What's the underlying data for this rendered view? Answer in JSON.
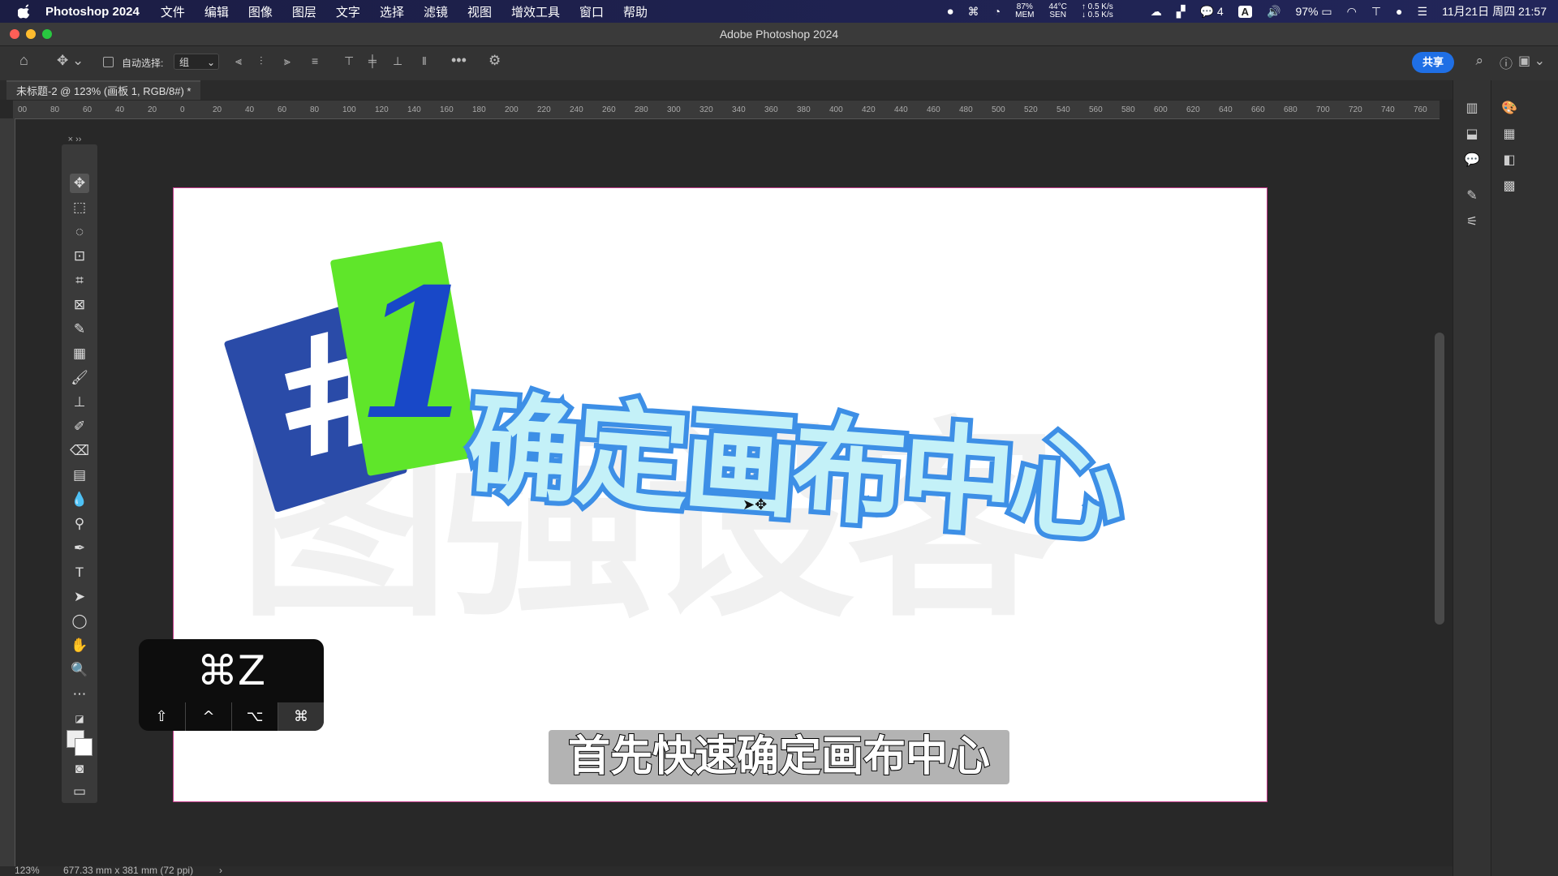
{
  "menubar": {
    "app_name": "Photoshop 2024",
    "menus": [
      "文件",
      "编辑",
      "图像",
      "图层",
      "文字",
      "选择",
      "滤镜",
      "视图",
      "增效工具",
      "窗口",
      "帮助"
    ],
    "stats": {
      "mem": "87%",
      "mem_label": "MEM",
      "temp": "44°C",
      "temp_label": "SEN",
      "net_up": "↑ 0.5 K/s",
      "net_down": "↓ 0.5 K/s"
    },
    "wechat_count": "4",
    "input_method": "A",
    "battery": "97%",
    "datetime": "11月21日 周四 21:57"
  },
  "window": {
    "title": "Adobe Photoshop 2024"
  },
  "options": {
    "auto_select_label": "自动选择:",
    "auto_select_value": "组",
    "share_label": "共享"
  },
  "document_tab": {
    "label": "未标题-2 @ 123% (画板 1, RGB/8#) *"
  },
  "ruler_top_ticks": [
    "00",
    "80",
    "60",
    "40",
    "20",
    "0",
    "20",
    "40",
    "60",
    "80",
    "100",
    "120",
    "140",
    "160",
    "180",
    "200",
    "220",
    "240",
    "260",
    "280",
    "300",
    "320",
    "340",
    "360",
    "380",
    "400",
    "420",
    "440",
    "460",
    "480",
    "500",
    "520",
    "540",
    "560",
    "580",
    "600",
    "620",
    "640",
    "660",
    "680",
    "700",
    "720",
    "740",
    "760"
  ],
  "canvas": {
    "badge_hash": "#",
    "badge_number": "1",
    "headline": "确定画布中心",
    "watermark": "图强设客",
    "colors": {
      "blue_tile": "#2a4ba8",
      "green_tile": "#5fe62a",
      "headline_fill": "#c4f1f8",
      "headline_outline": "#3d8fe6",
      "number_color": "#1848c8"
    }
  },
  "shortcut_overlay": {
    "main": "⌘Z",
    "modifiers": [
      "⇧",
      "^",
      "⌥",
      "⌘"
    ],
    "active_index": 3
  },
  "caption": "首先快速确定画布中心",
  "status": {
    "zoom": "123%",
    "doc_size": "677.33 mm x 381 mm (72 ppi)"
  }
}
